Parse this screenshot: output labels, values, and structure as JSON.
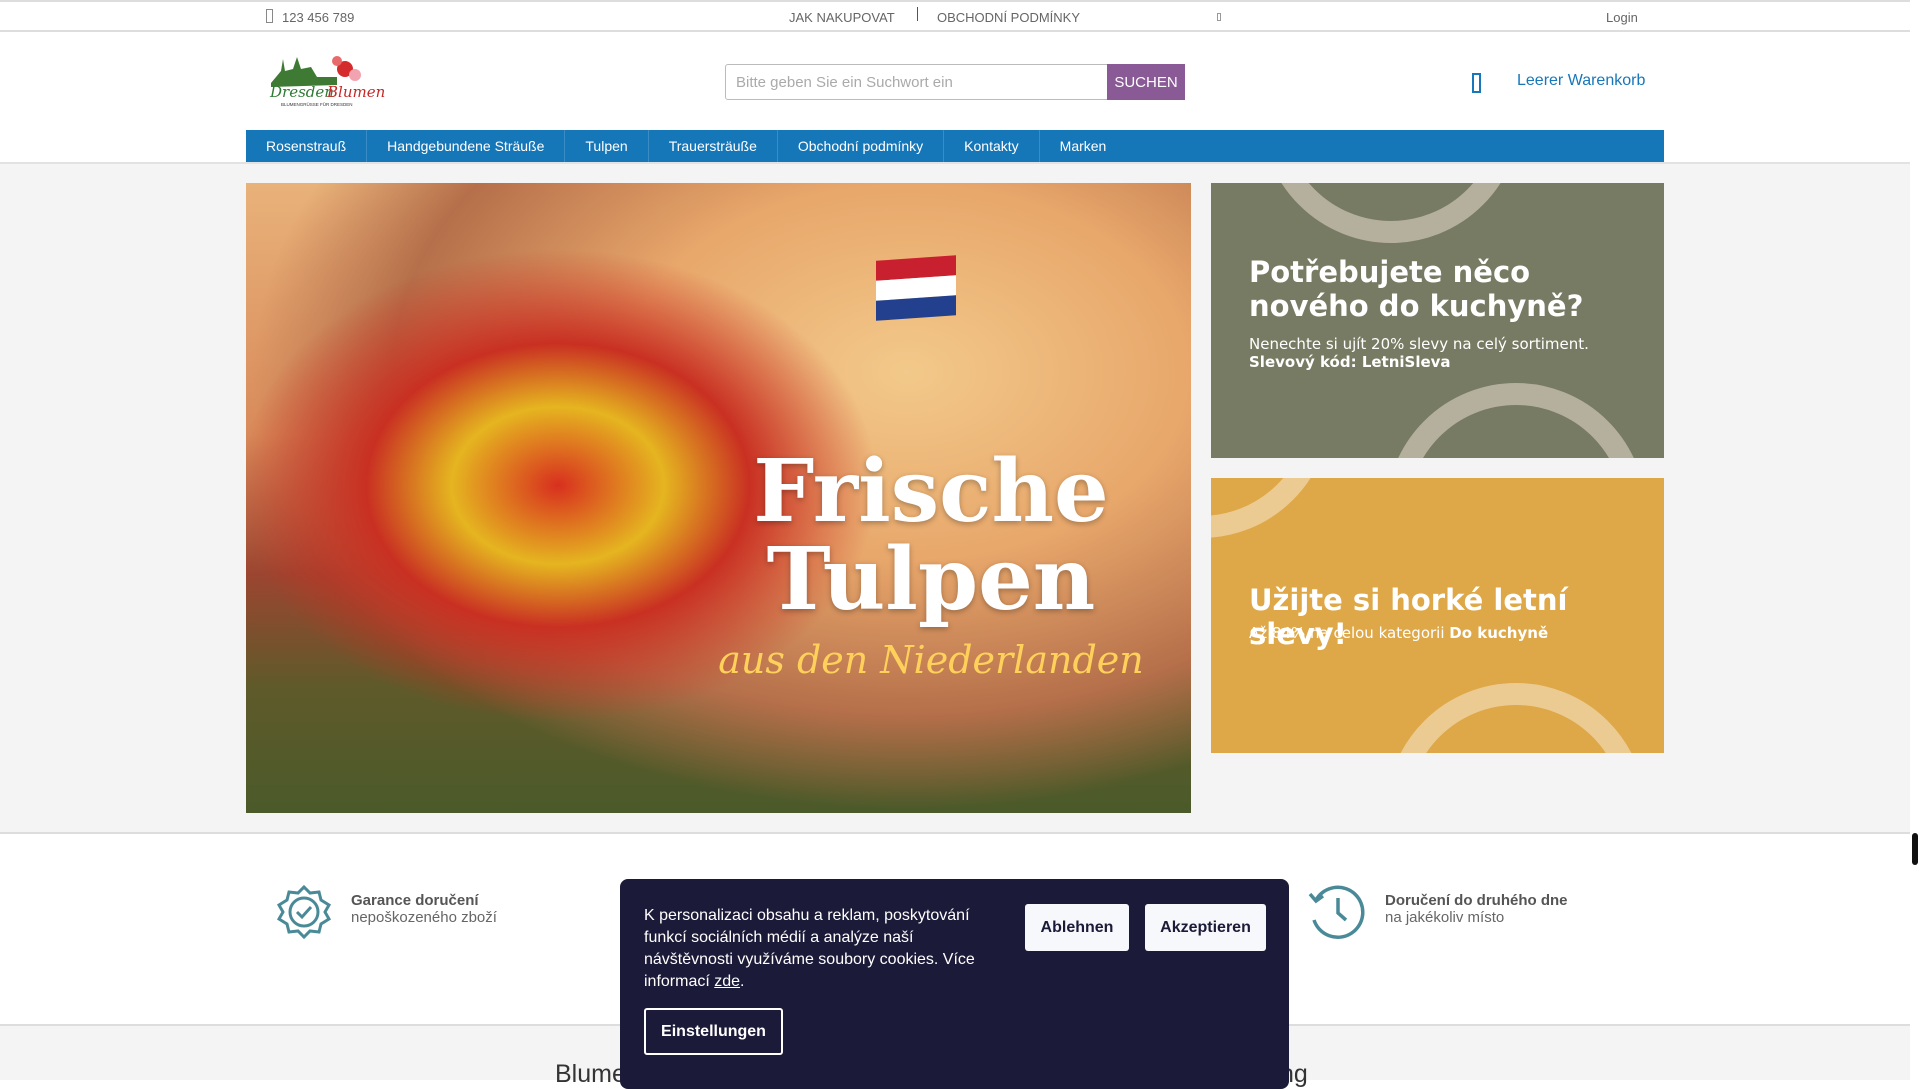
{
  "topbar": {
    "phone": "123 456 789",
    "links": [
      "JAK NAKUPOVAT",
      "OBCHODNÍ PODMÍNKY"
    ],
    "login": "Login"
  },
  "header": {
    "logo_text": "Dresden Blumen",
    "logo_tagline": "Blumengrüße für Dresden",
    "search_placeholder": "Bitte geben Sie ein Suchwort ein",
    "search_button": "SUCHEN",
    "cart": "Leerer Warenkorb"
  },
  "nav": [
    "Rosenstrauß",
    "Handgebundene Sträuße",
    "Tulpen",
    "Trauersträuße",
    "Obchodní podmínky",
    "Kontakty",
    "Marken"
  ],
  "hero": {
    "title_line1": "Frische",
    "title_line2": "Tulpen",
    "subtitle": "aus den Niederlanden"
  },
  "banners": [
    {
      "title": "Potřebujete něco nového do kuchyně?",
      "text": "Nenechte si ujít 20% slevy na celý sortiment.",
      "code": "Slevový kód: LetniSleva",
      "color": "#787b63"
    },
    {
      "title": "Užijte si horké letní slevy!",
      "text": "Až 84% na celou kategorii",
      "highlight": "Do kuchyně",
      "color": "#dea848"
    }
  ],
  "features": [
    {
      "title": "Garance doručení",
      "text": "nepoškozeného zboží"
    },
    {
      "title": "Doručení do druhého dne",
      "text": "na jakékoliv místo"
    }
  ],
  "bottom_heading": {
    "left": "Blume",
    "right": "ng"
  },
  "cookie": {
    "text": "K personalizaci obsahu a reklam, poskytování funkcí sociálních médií a analýze naší návštěvnosti využíváme soubory cookies. Více informací",
    "link": "zde",
    "reject": "Ablehnen",
    "accept": "Akzeptieren",
    "settings": "Einstellungen"
  }
}
